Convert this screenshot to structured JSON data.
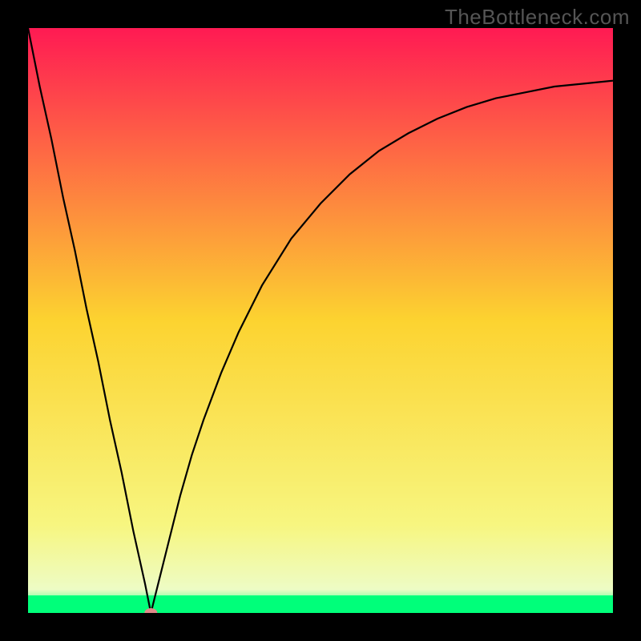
{
  "watermark": "TheBottleneck.com",
  "chart_data": {
    "type": "line",
    "title": "",
    "xlabel": "",
    "ylabel": "",
    "xlim": [
      0,
      100
    ],
    "ylim": [
      0,
      100
    ],
    "grid": false,
    "legend": false,
    "marker": {
      "x": 21,
      "y": 0,
      "color": "#e08a8a"
    },
    "green_band": {
      "from_y": 0,
      "to_y": 3
    },
    "background_gradient": {
      "stops": [
        {
          "offset": 0,
          "color": "#ff1a53"
        },
        {
          "offset": 50,
          "color": "#fcd330"
        },
        {
          "offset": 85,
          "color": "#f7f680"
        },
        {
          "offset": 96,
          "color": "#edfcc5"
        },
        {
          "offset": 100,
          "color": "#00ff7a"
        }
      ]
    },
    "series": [
      {
        "name": "bottleneck-curve",
        "color": "#000000",
        "x": [
          0,
          2,
          4,
          6,
          8,
          10,
          12,
          14,
          16,
          18,
          20,
          21,
          22,
          24,
          26,
          28,
          30,
          33,
          36,
          40,
          45,
          50,
          55,
          60,
          65,
          70,
          75,
          80,
          85,
          90,
          95,
          100
        ],
        "y": [
          100,
          90,
          81,
          71,
          62,
          52,
          43,
          33,
          24,
          14,
          5,
          0,
          4,
          12,
          20,
          27,
          33,
          41,
          48,
          56,
          64,
          70,
          75,
          79,
          82,
          84.5,
          86.5,
          88,
          89,
          90,
          90.5,
          91
        ]
      }
    ]
  }
}
